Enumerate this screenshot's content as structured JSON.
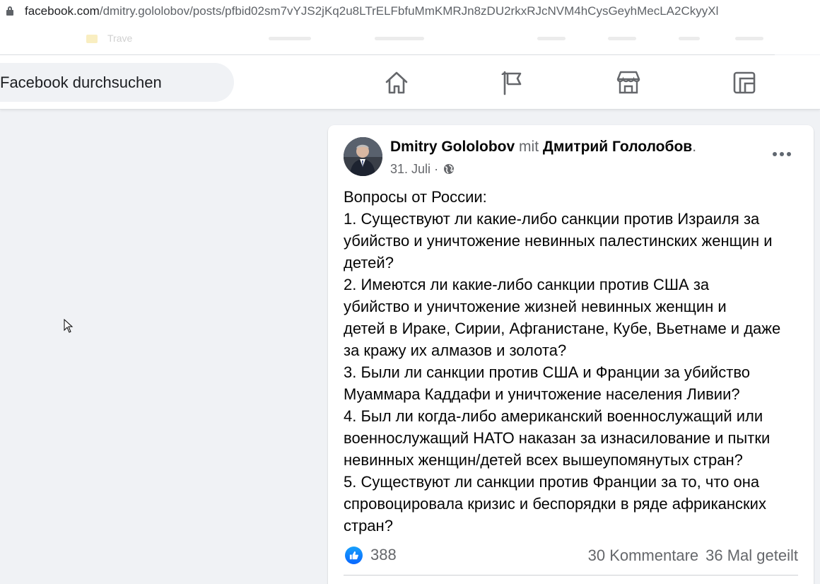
{
  "browser": {
    "url_domain": "facebook.com",
    "url_path": "/dmitry.gololobov/posts/pfbid02sm7vYJS2jKq2u8LTrELFbfuMmKMRJn8zDU2rkxRJcNVM4hCysGeyhMecLA2CkyyXl",
    "bookmark_label": "Trave"
  },
  "nav": {
    "search_placeholder": "Facebook durchsuchen",
    "icons": [
      "home-icon",
      "pages-flag-icon",
      "marketplace-icon",
      "gaming-icon"
    ]
  },
  "post": {
    "author": "Dmitry Gololobov",
    "with_word": "mit",
    "tagged": "Дмитрий Гололобов",
    "tagged_suffix": ".",
    "date": "31. Juli",
    "separator": "·",
    "audience_icon": "globe-icon",
    "lines": [
      "Вопросы от России:",
      "1. Существуют ли какие-либо санкции против Израиля за",
      "убийство и уничтожение невинных палестинских женщин и",
      "детей?",
      "2. Имеются ли какие-либо санкции против США за",
      "убийство и уничтожение жизней невинных женщин и",
      "детей в Ираке, Сирии, Афганистане, Кубе, Вьетнаме и даже",
      "за кражу их алмазов и золота?",
      "3. Были ли санкции против США и Франции за убийство",
      "Муаммара Каддафи и уничтожение населения Ливии?",
      "4. Был ли когда-либо американский военнослужащий или",
      "военнослужащий НАТО наказан за изнасилование и пытки",
      "невинных женщин/детей всех вышеупомянутых стран?",
      "5. Существуют ли санкции против Франции за то, что она",
      "спровоцировала кризис и беспорядки в ряде африканских",
      "стран?"
    ],
    "likes": "388",
    "comments": "30 Kommentare",
    "shares": "36 Mal geteilt"
  },
  "colors": {
    "accent": "#0866ff",
    "background": "#f0f2f5",
    "secondary_text": "#65676b"
  }
}
